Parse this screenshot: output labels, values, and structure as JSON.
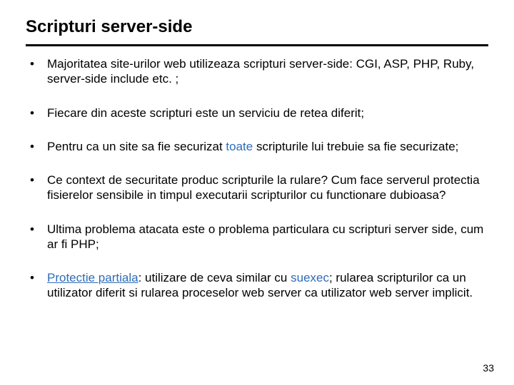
{
  "title": "Scripturi server-side",
  "bullets": [
    {
      "segments": [
        {
          "text": "Majoritatea site-urilor web utilizeaza scripturi server-side: CGI, ASP, PHP, Ruby, server-side include etc. ;"
        }
      ]
    },
    {
      "segments": [
        {
          "text": "Fiecare din aceste scripturi este un serviciu de retea diferit;"
        }
      ]
    },
    {
      "segments": [
        {
          "text": "Pentru ca un site sa fie securizat "
        },
        {
          "text": "toate",
          "link": true
        },
        {
          "text": " scripturile lui trebuie sa fie securizate;"
        }
      ]
    },
    {
      "segments": [
        {
          "text": "Ce context de securitate produc scripturile la rulare? Cum face serverul protectia fisierelor sensibile in timpul executarii scripturilor cu functionare dubioasa?"
        }
      ]
    },
    {
      "segments": [
        {
          "text": "Ultima problema atacata este o problema particulara cu scripturi server side, cum ar fi PHP;"
        }
      ]
    },
    {
      "segments": [
        {
          "text": "Protectie partiala",
          "link": true,
          "underline": true
        },
        {
          "text": ": utilizare de ceva similar cu "
        },
        {
          "text": "suexec",
          "link": true
        },
        {
          "text": "; rularea scripturilor ca un utilizator diferit si rularea proceselor web server ca utilizator web server implicit."
        }
      ]
    }
  ],
  "page_number": "33"
}
